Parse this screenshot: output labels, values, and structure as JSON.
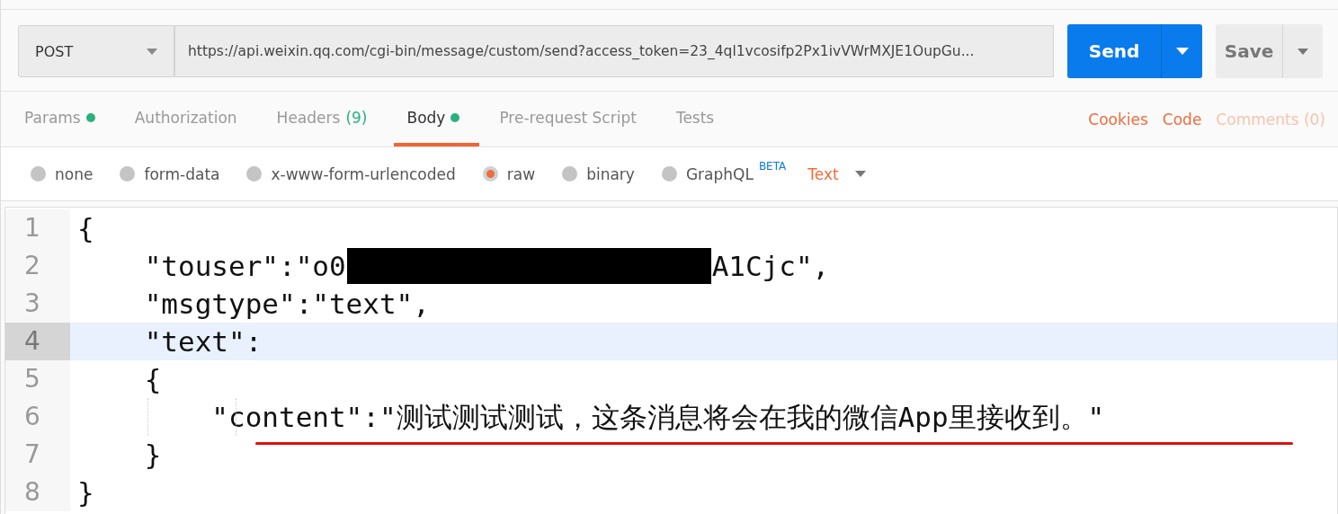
{
  "request": {
    "method": "POST",
    "url": "https://api.weixin.qq.com/cgi-bin/message/custom/send?access_token=23_4ql1vcosifp2Px1ivVWrMXJE1OupGu...",
    "send_label": "Send",
    "save_label": "Save"
  },
  "tabs": [
    {
      "label": "Params",
      "dot": true,
      "selected": false
    },
    {
      "label": "Authorization",
      "dot": false,
      "selected": false
    },
    {
      "label": "Headers",
      "count": "(9)",
      "dot": false,
      "selected": false
    },
    {
      "label": "Body",
      "dot": true,
      "selected": true
    },
    {
      "label": "Pre-request Script",
      "dot": false,
      "selected": false
    },
    {
      "label": "Tests",
      "dot": false,
      "selected": false
    }
  ],
  "links": [
    {
      "label": "Cookies",
      "disabled": false
    },
    {
      "label": "Code",
      "disabled": false
    },
    {
      "label": "Comments (0)",
      "disabled": true
    }
  ],
  "body_types": [
    {
      "label": "none",
      "selected": false
    },
    {
      "label": "form-data",
      "selected": false
    },
    {
      "label": "x-www-form-urlencoded",
      "selected": false
    },
    {
      "label": "raw",
      "selected": true
    },
    {
      "label": "binary",
      "selected": false
    },
    {
      "label": "GraphQL",
      "badge": "BETA",
      "selected": false
    }
  ],
  "format": "Text",
  "editor": {
    "lines": [
      {
        "number": "1",
        "parts": [
          "{"
        ],
        "selected": false
      },
      {
        "number": "2",
        "parts": [
          "    \"touser\":\"o0",
          "A1Cjc\","
        ],
        "selected": false
      },
      {
        "number": "3",
        "parts": [
          "    \"msgtype\":\"text\","
        ],
        "selected": false
      },
      {
        "number": "4",
        "parts": [
          "    \"text\":"
        ],
        "selected": true
      },
      {
        "number": "5",
        "parts": [
          "    {"
        ],
        "selected": false
      },
      {
        "number": "6",
        "parts": [
          "        \"content\":\"测试测试测试，这条消息将会在我的微信App里接收到。\""
        ],
        "selected": false,
        "underlined": true
      },
      {
        "number": "7",
        "parts": [
          "    }"
        ],
        "selected": false
      },
      {
        "number": "8",
        "parts": [
          "}"
        ],
        "selected": false
      }
    ]
  }
}
